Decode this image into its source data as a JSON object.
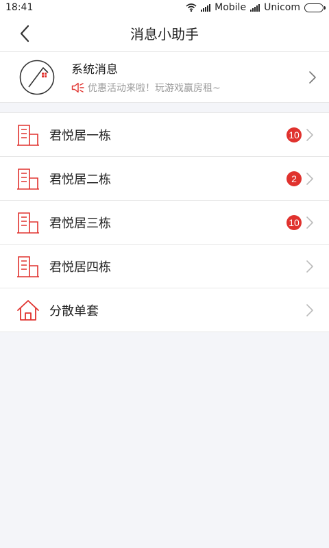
{
  "status_bar": {
    "time": "18:41",
    "carrier1": "Mobile",
    "carrier2": "Unicom"
  },
  "header": {
    "title": "消息小助手"
  },
  "system": {
    "title": "系统消息",
    "subtitle": "优惠活动来啦！玩游戏赢房租~"
  },
  "buildings": [
    {
      "label": "君悦居一栋",
      "badge": "10"
    },
    {
      "label": "君悦居二栋",
      "badge": "2"
    },
    {
      "label": "君悦居三栋",
      "badge": "10"
    },
    {
      "label": "君悦居四栋",
      "badge": ""
    },
    {
      "label": "分散单套",
      "badge": ""
    }
  ],
  "colors": {
    "accent": "#e0322e",
    "background": "#f4f5f9"
  }
}
